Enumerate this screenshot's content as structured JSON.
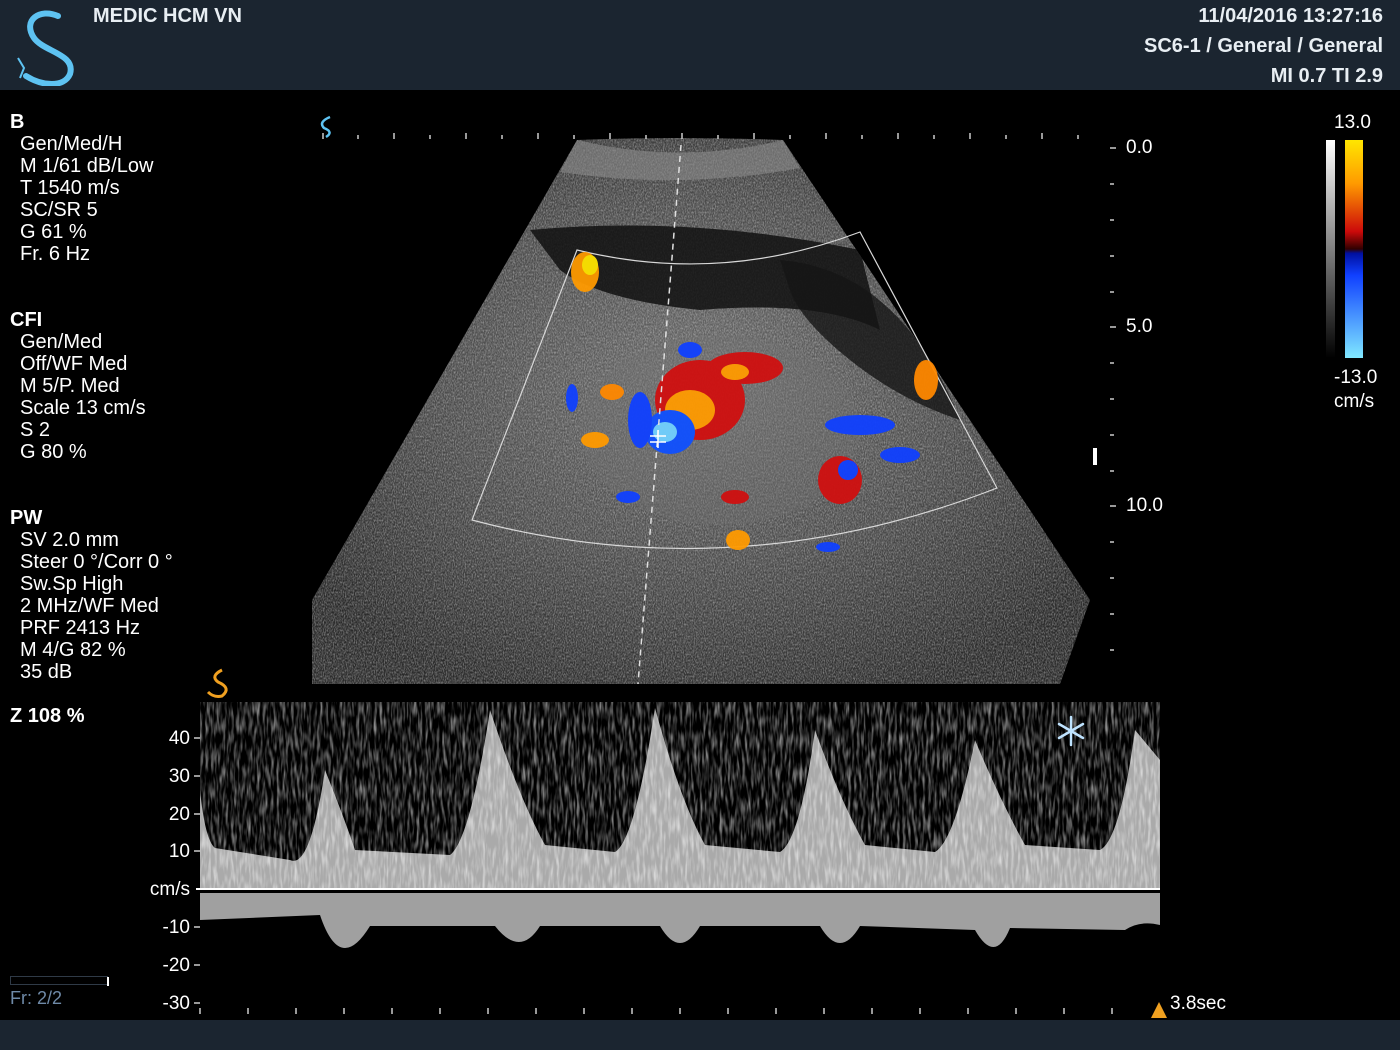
{
  "header": {
    "institution": "MEDIC HCM VN",
    "datetime": "11/04/2016 13:27:16",
    "probe_preset": "SC6-1 / General / General",
    "mi_ti": "MI 0.7  TI 2.9"
  },
  "b_mode": {
    "title": "B",
    "lines": [
      "Gen/Med/H",
      "M 1/61 dB/Low",
      "T 1540 m/s",
      "SC/SR 5",
      "G 61 %",
      "Fr. 6 Hz"
    ]
  },
  "cfi": {
    "title": "CFI",
    "lines": [
      "Gen/Med",
      "Off/WF Med",
      "M 5/P. Med",
      "Scale 13 cm/s",
      "S 2",
      "G 80 %"
    ]
  },
  "pw": {
    "title": "PW",
    "lines": [
      "SV 2.0 mm",
      "Steer 0 °/Corr 0 °",
      "Sw.Sp High",
      "2 MHz/WF Med",
      "PRF 2413 Hz",
      "M 4/G 82 %",
      "35 dB"
    ]
  },
  "zoom": "Z  108  %",
  "depth_scale": {
    "labels": [
      "0.0",
      "5.0",
      "10.0"
    ]
  },
  "color_bar": {
    "max": "13.0",
    "min": "-13.0",
    "unit": "cm/s"
  },
  "doppler": {
    "velocity_labels": [
      "40",
      "30",
      "20",
      "10",
      "cm/s",
      "-10",
      "-20",
      "-30"
    ],
    "sweep_time": "3.8sec",
    "freeze_icon": "snowflake-icon"
  },
  "frame_counter": "Fr: 2/2",
  "colors": {
    "panel": "#1b2530",
    "brand": "#5ec3f2",
    "pw_marker": "#f0a020"
  }
}
